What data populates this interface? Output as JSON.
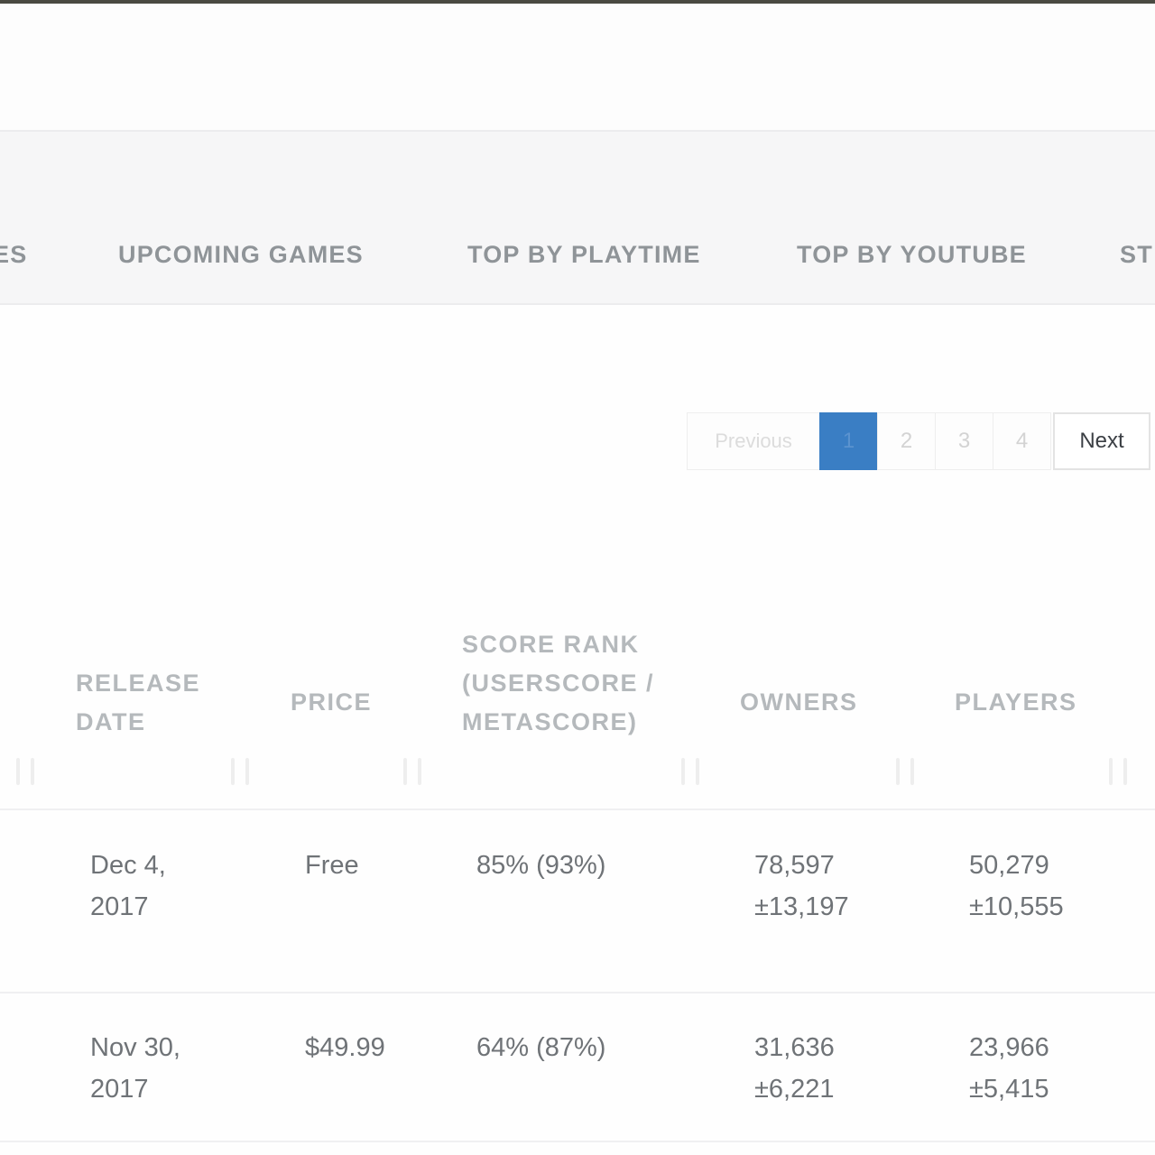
{
  "nav": {
    "items": [
      {
        "label": "ES"
      },
      {
        "label": "UPCOMING GAMES"
      },
      {
        "label": "TOP BY PLAYTIME"
      },
      {
        "label": "TOP BY YOUTUBE"
      },
      {
        "label": "ST"
      }
    ]
  },
  "pagination": {
    "previous": "Previous",
    "pages": [
      "1",
      "2",
      "3",
      "4"
    ],
    "current": "1",
    "next": "Next",
    "active_color": "#3a7ec4"
  },
  "table": {
    "headers": {
      "release_date": "RELEASE DATE",
      "price": "PRICE",
      "score_rank": "SCORE RANK (USERSCORE / METASCORE)",
      "owners": "OWNERS",
      "players": "PLAYERS"
    },
    "rows": [
      {
        "release_date_line1": "Dec 4,",
        "release_date_line2": "2017",
        "price": "Free",
        "score": "85% (93%)",
        "owners": "78,597",
        "owners_err": "±13,197",
        "players": "50,279",
        "players_err": "±10,555"
      },
      {
        "release_date_line1": "Nov 30,",
        "release_date_line2": "2017",
        "price": "$49.99",
        "score": "64% (87%)",
        "owners": "31,636",
        "owners_err": "±6,221",
        "players": "23,966",
        "players_err": "±5,415"
      }
    ]
  }
}
